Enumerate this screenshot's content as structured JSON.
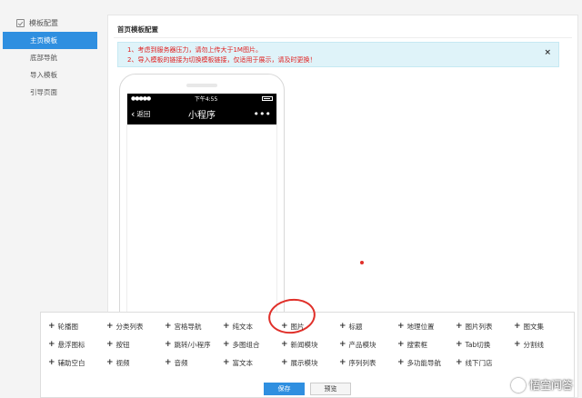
{
  "sidebar": {
    "header": "模板配置",
    "items": [
      {
        "label": "主页模板",
        "active": true
      },
      {
        "label": "底部导航",
        "active": false
      },
      {
        "label": "导入模板",
        "active": false
      },
      {
        "label": "引导页面",
        "active": false
      }
    ]
  },
  "main": {
    "title": "首页模板配置",
    "notice": {
      "line1": "1、考虑到服务器压力，请勿上传大于1M图片。",
      "line2": "2、导入模板的链接为切换模板链接，仅适用于展示，请及时更换！",
      "close": "×"
    },
    "phone": {
      "status_left": "●●●●●",
      "status_time": "下午4:55",
      "back_label": "返回",
      "title": "小程序",
      "more": "•••"
    }
  },
  "palette": {
    "rows": [
      [
        "轮播图",
        "分类列表",
        "宫格导航",
        "纯文本",
        "图片",
        "标题",
        "地理位置",
        "图片列表",
        "图文集"
      ],
      [
        "悬浮图标",
        "按钮",
        "跳转/小程序",
        "多图组合",
        "新闻模块",
        "产品模块",
        "搜索框",
        "Tab切换",
        "分割线"
      ],
      [
        "辅助空白",
        "视频",
        "音频",
        "富文本",
        "展示模块",
        "序列列表",
        "多功能导航",
        "线下门店"
      ]
    ],
    "save_label": "保存",
    "preview_label": "预览"
  },
  "watermark": "悟空问答",
  "colors": {
    "accent": "#2f8fe0",
    "notice_bg": "#dff3f9",
    "notice_text": "#e02020",
    "annotation": "#e0302a"
  }
}
